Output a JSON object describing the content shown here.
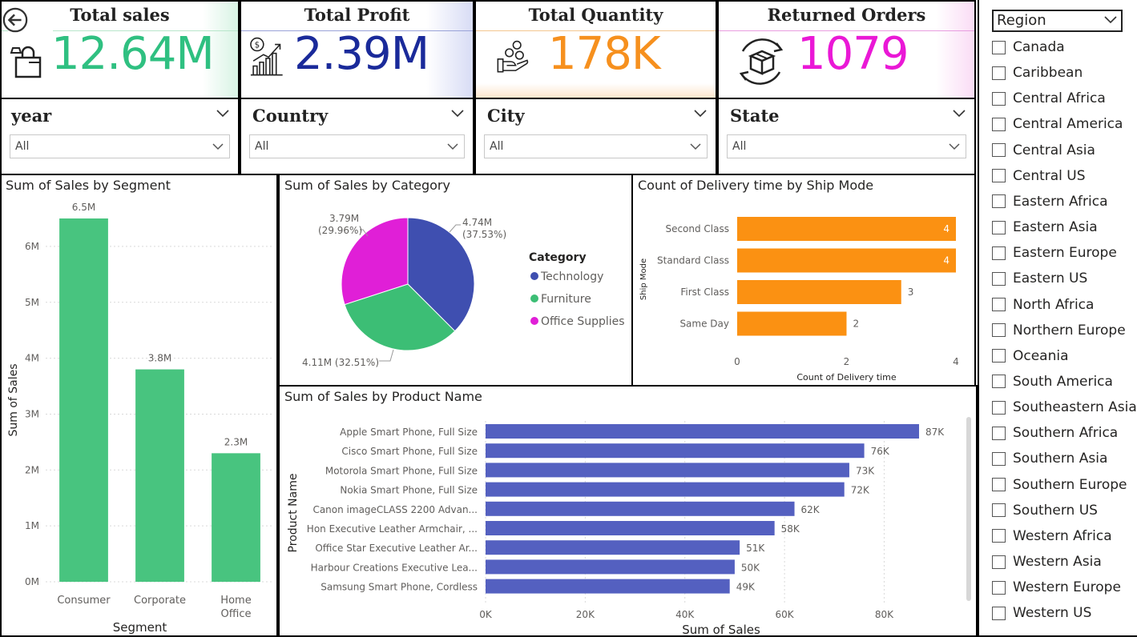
{
  "kpis": [
    {
      "title": "Total sales",
      "value": "12.64M",
      "color": "#2fc081"
    },
    {
      "title": "Total Profit",
      "value": "2.39M",
      "color": "#1a2a9a"
    },
    {
      "title": "Total Quantity",
      "value": "178K",
      "color": "#f6901e"
    },
    {
      "title": "Returned Orders",
      "value": "1079",
      "color": "#ea18d6"
    }
  ],
  "filters": [
    {
      "title": "year",
      "value": "All"
    },
    {
      "title": "Country",
      "value": "All"
    },
    {
      "title": "City",
      "value": "All"
    },
    {
      "title": "State",
      "value": "All"
    }
  ],
  "region": {
    "title": "Region",
    "items": [
      "Canada",
      "Caribbean",
      "Central Africa",
      "Central America",
      "Central Asia",
      "Central US",
      "Eastern Africa",
      "Eastern Asia",
      "Eastern Europe",
      "Eastern US",
      "North Africa",
      "Northern Europe",
      "Oceania",
      "South America",
      "Southeastern Asia",
      "Southern Africa",
      "Southern Asia",
      "Southern Europe",
      "Southern US",
      "Western Africa",
      "Western Asia",
      "Western Europe",
      "Western US"
    ]
  },
  "chart_data": [
    {
      "id": "segment",
      "type": "bar",
      "title": "Sum of Sales by Segment",
      "xlabel": "Segment",
      "ylabel": "Sum of Sales",
      "categories": [
        "Consumer",
        "Corporate",
        "Home Office"
      ],
      "values": [
        6500000,
        3800000,
        2300000
      ],
      "data_labels": [
        "6.5M",
        "3.8M",
        "2.3M"
      ],
      "ylim": [
        0,
        6500000
      ],
      "yticks": [
        "0M",
        "1M",
        "2M",
        "3M",
        "4M",
        "5M",
        "6M"
      ],
      "color": "#48c47f",
      "grid": true
    },
    {
      "id": "category",
      "type": "pie",
      "title": "Sum of Sales by Category",
      "legend_title": "Category",
      "legend_position": "right",
      "categories": [
        "Technology",
        "Furniture",
        "Office Supplies"
      ],
      "values": [
        4.74,
        4.11,
        3.79
      ],
      "percents": [
        37.53,
        32.51,
        29.96
      ],
      "labels": [
        "4.74M",
        "4.11M (32.51%)",
        "3.79M"
      ],
      "pct_labels": [
        "(37.53%)",
        "",
        "(29.96%)"
      ],
      "colors": [
        "#3f4fb0",
        "#3cbe75",
        "#e01fd7"
      ]
    },
    {
      "id": "shipmode",
      "type": "bar",
      "orientation": "horizontal",
      "title": "Count of Delivery time by Ship Mode",
      "xlabel": "Count of Delivery time",
      "ylabel": "Ship Mode",
      "categories": [
        "Second Class",
        "Standard Class",
        "First Class",
        "Same Day"
      ],
      "values": [
        4,
        4,
        3,
        2
      ],
      "xlim": [
        0,
        4
      ],
      "xticks": [
        "0",
        "2",
        "4"
      ],
      "color": "#fb9112"
    },
    {
      "id": "product",
      "type": "bar",
      "orientation": "horizontal",
      "title": "Sum of Sales by Product Name",
      "xlabel": "Sum of Sales",
      "ylabel": "Product Name",
      "categories": [
        "Apple Smart Phone, Full Size",
        "Cisco Smart Phone, Full Size",
        "Motorola Smart Phone, Full Size",
        "Nokia Smart Phone, Full Size",
        "Canon imageCLASS 2200 Advan...",
        "Hon Executive Leather Armchair, ...",
        "Office Star Executive Leather Ar...",
        "Harbour Creations Executive Lea...",
        "Samsung Smart Phone, Cordless"
      ],
      "values": [
        87000,
        76000,
        73000,
        72000,
        62000,
        58000,
        51000,
        50000,
        49000
      ],
      "data_labels": [
        "87K",
        "76K",
        "73K",
        "72K",
        "62K",
        "58K",
        "51K",
        "50K",
        "49K"
      ],
      "xlim": [
        0,
        87000
      ],
      "xticks": [
        "0K",
        "20K",
        "40K",
        "60K",
        "80K"
      ],
      "color": "#5460c0"
    }
  ]
}
